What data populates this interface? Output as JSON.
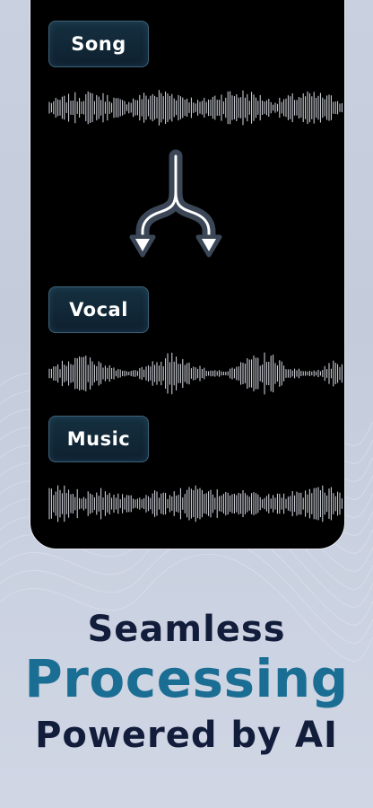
{
  "stems": {
    "song_label": "Song",
    "vocal_label": "Vocal",
    "music_label": "Music"
  },
  "headline": {
    "line1": "Seamless",
    "line2": "Processing",
    "line3": "Powered by AI"
  },
  "icons": {
    "split": "split-arrow-icon"
  },
  "colors": {
    "background": "#c9d1e0",
    "phone_screen": "#000000",
    "chip_fill": "#15303f",
    "chip_border": "#3d6278",
    "waveform": "#ffffff",
    "headline_dark": "#121d3b",
    "headline_accent": "#1a6d93"
  }
}
